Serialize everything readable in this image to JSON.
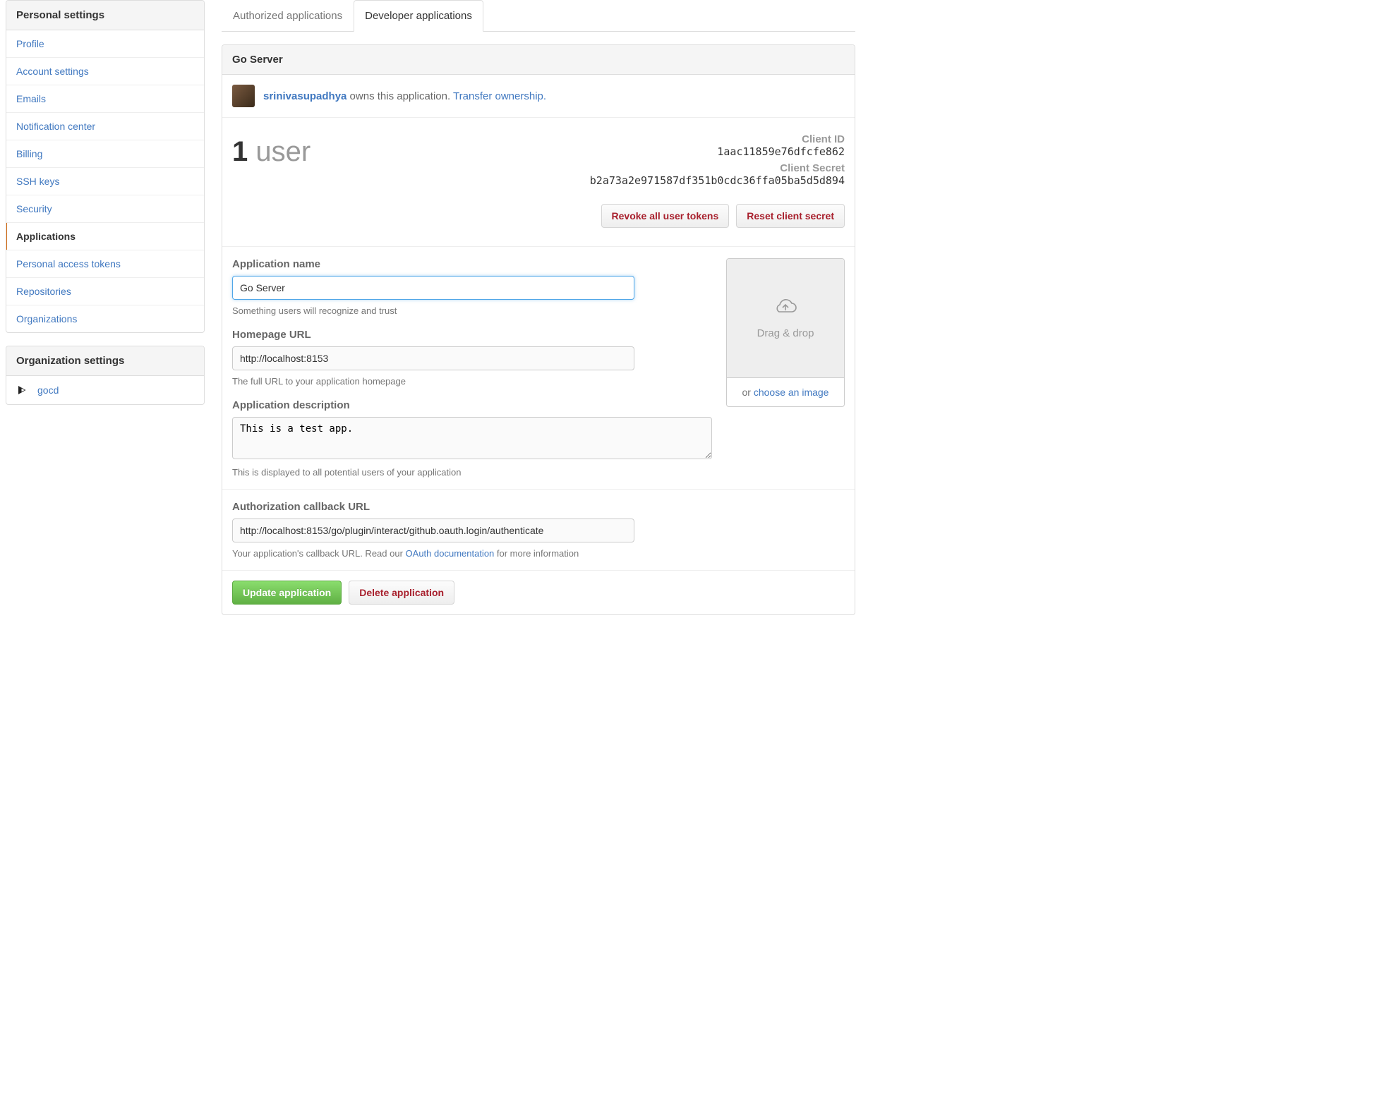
{
  "sidebar": {
    "personal_heading": "Personal settings",
    "items": [
      {
        "label": "Profile"
      },
      {
        "label": "Account settings"
      },
      {
        "label": "Emails"
      },
      {
        "label": "Notification center"
      },
      {
        "label": "Billing"
      },
      {
        "label": "SSH keys"
      },
      {
        "label": "Security"
      },
      {
        "label": "Applications"
      },
      {
        "label": "Personal access tokens"
      },
      {
        "label": "Repositories"
      },
      {
        "label": "Organizations"
      }
    ],
    "org_heading": "Organization settings",
    "org_items": [
      {
        "label": "gocd"
      }
    ]
  },
  "tabs": {
    "authorized": "Authorized applications",
    "developer": "Developer applications"
  },
  "app": {
    "name": "Go Server",
    "owner_username": "srinivasupadhya",
    "owner_owns_text": " owns this application. ",
    "transfer_text": "Transfer ownership.",
    "user_count_num": "1",
    "user_count_label": " user",
    "client_id_label": "Client ID",
    "client_id_value": "1aac11859e76dfcfe862",
    "client_secret_label": "Client Secret",
    "client_secret_value": "b2a73a2e971587df351b0cdc36ffa05ba5d5d894",
    "revoke_btn": "Revoke all user tokens",
    "reset_btn": "Reset client secret"
  },
  "form": {
    "name_label": "Application name",
    "name_value": "Go Server",
    "name_hint": "Something users will recognize and trust",
    "homepage_label": "Homepage URL",
    "homepage_value": "http://localhost:8153",
    "homepage_hint": "The full URL to your application homepage",
    "desc_label": "Application description",
    "desc_value": "This is a test app.",
    "desc_hint": "This is displayed to all potential users of your application",
    "callback_label": "Authorization callback URL",
    "callback_value": "http://localhost:8153/go/plugin/interact/github.oauth.login/authenticate",
    "callback_hint_pre": "Your application's callback URL. Read our ",
    "callback_hint_link": "OAuth documentation",
    "callback_hint_post": " for more information",
    "drag_label": "Drag & drop",
    "choose_pre": "or ",
    "choose_link": "choose an image",
    "update_btn": "Update application",
    "delete_btn": "Delete application"
  }
}
